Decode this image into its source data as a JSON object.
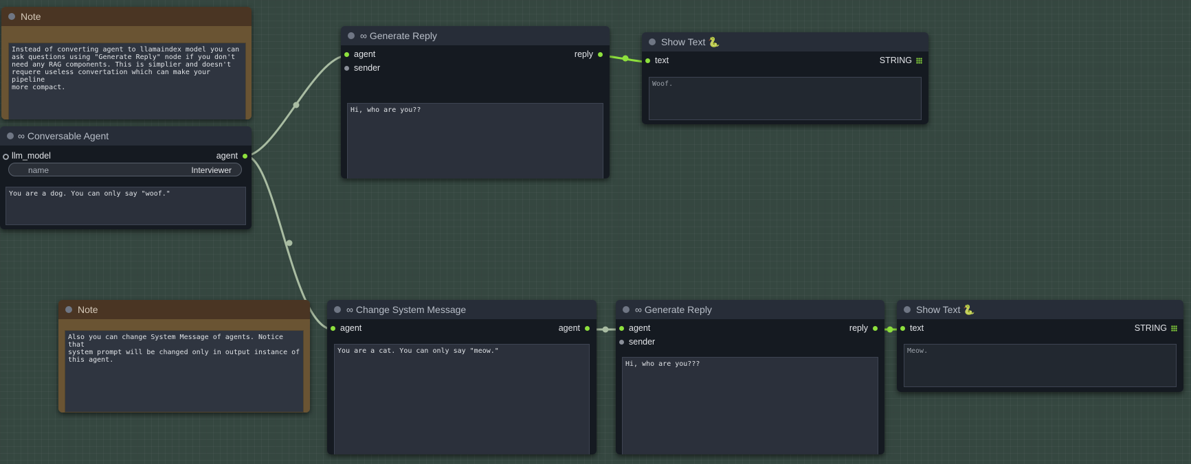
{
  "notes": [
    {
      "title": "Note",
      "text": "Instead of converting agent to llamaindex model you can\nask questions using \"Generate Reply\" node if you don't\nneed any RAG components. This is simplier and doesn't\nrequere useless convertation which can make your pipeline\nmore compact."
    },
    {
      "title": "Note",
      "text": "Also you can change System Message of agents. Notice that\nsystem prompt will be changed only in output instance of\nthis agent."
    }
  ],
  "conversable_agent": {
    "title": "∞ Conversable Agent",
    "input_llm": "llm_model",
    "output_agent": "agent",
    "name_label": "name",
    "name_value": "Interviewer",
    "system_message": "You are a dog. You can only say \"woof.\""
  },
  "generate_reply_1": {
    "title": "∞ Generate Reply",
    "input_agent": "agent",
    "input_sender": "sender",
    "output_reply": "reply",
    "message": "Hi, who are you??"
  },
  "show_text_1": {
    "title": "Show Text 🐍",
    "input_text": "text",
    "output_type": "STRING",
    "value": "Woof."
  },
  "change_system_message": {
    "title": "∞ Change System Message",
    "input_agent": "agent",
    "output_agent": "agent",
    "message": "You are a cat. You can only say \"meow.\""
  },
  "generate_reply_2": {
    "title": "∞ Generate Reply",
    "input_agent": "agent",
    "input_sender": "sender",
    "output_reply": "reply",
    "message": "Hi, who are you???"
  },
  "show_text_2": {
    "title": "Show Text 🐍",
    "input_text": "text",
    "output_type": "STRING",
    "value": "Meow."
  },
  "colors": {
    "link_agent": "#a9bca2",
    "link_string": "#8ee03d",
    "pin_agent": "#8ee03d"
  }
}
